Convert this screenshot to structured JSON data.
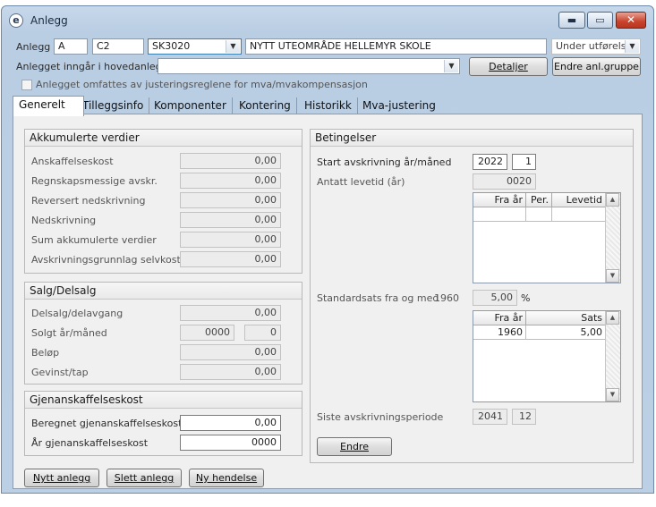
{
  "window": {
    "title": "Anlegg",
    "icon": "app-e-icon",
    "controls": [
      "minimize",
      "maximize",
      "close"
    ]
  },
  "header": {
    "anlegg_label": "Anlegg",
    "anlegg_code1": "A",
    "anlegg_code2": "C2",
    "anlegg_number": "SK3020",
    "anlegg_name": "NYTT UTEOMRÅDE HELLEMYR SKOLE",
    "status": "Under utførelse",
    "hovedanlegg_label": "Anlegget inngår i hovedanlegg",
    "hovedanlegg_value": "",
    "detaljer_button": "Detaljer",
    "endre_gruppe_button": "Endre anl.gruppe",
    "mva_checkbox_label": "Anlegget omfattes av justeringsreglene for mva/mvakompensasjon",
    "mva_checked": false
  },
  "tabs": [
    "Generelt",
    "Tilleggsinfo",
    "Komponenter",
    "Kontering",
    "Historikk",
    "Mva-justering"
  ],
  "active_tab": "Generelt",
  "akkumulerte": {
    "title": "Akkumulerte verdier",
    "rows": [
      {
        "label": "Anskaffelseskost",
        "value": "0,00"
      },
      {
        "label": "Regnskapsmessige avskr.",
        "value": "0,00"
      },
      {
        "label": "Reversert nedskrivning",
        "value": "0,00"
      },
      {
        "label": "Nedskrivning",
        "value": "0,00"
      },
      {
        "label": "Sum akkumulerte verdier",
        "value": "0,00"
      },
      {
        "label": "Avskrivningsgrunnlag selvkost",
        "value": "0,00"
      }
    ]
  },
  "salg": {
    "title": "Salg/Delsalg",
    "delsalg_label": "Delsalg/delavgang",
    "delsalg_value": "0,00",
    "solgt_label": "Solgt år/måned",
    "solgt_year": "0000",
    "solgt_month": "0",
    "belop_label": "Beløp",
    "belop_value": "0,00",
    "gevinst_label": "Gevinst/tap",
    "gevinst_value": "0,00"
  },
  "gjenanskaffelse": {
    "title": "Gjenanskaffelseskost",
    "beregnet_label": "Beregnet gjenanskaffelseskost",
    "beregnet_value": "0,00",
    "ar_label": "År gjenanskaffelseskost",
    "ar_value": "0000"
  },
  "betingelser": {
    "title": "Betingelser",
    "start_label": "Start avskrivning år/måned",
    "start_year": "2022",
    "start_month": "1",
    "levetid_label": "Antatt levetid (år)",
    "levetid_value": "0020",
    "levetid_grid": {
      "headers": [
        "Fra år",
        "Per.",
        "Levetid"
      ],
      "rows": [
        [
          "",
          "",
          ""
        ]
      ]
    },
    "standardsats_label": "Standardsats fra og med",
    "standardsats_year": "1960",
    "standardsats_value": "5,00",
    "percent_sign": "%",
    "sats_grid": {
      "headers": [
        "Fra år",
        "Sats"
      ],
      "rows": [
        [
          "1960",
          "5,00"
        ]
      ]
    },
    "siste_label": "Siste avskrivningsperiode",
    "siste_year": "2041",
    "siste_month": "12",
    "endre_button": "Endre"
  },
  "footer": {
    "nytt_button": "Nytt anlegg",
    "slett_button": "Slett anlegg",
    "hendelse_button": "Ny hendelse"
  }
}
